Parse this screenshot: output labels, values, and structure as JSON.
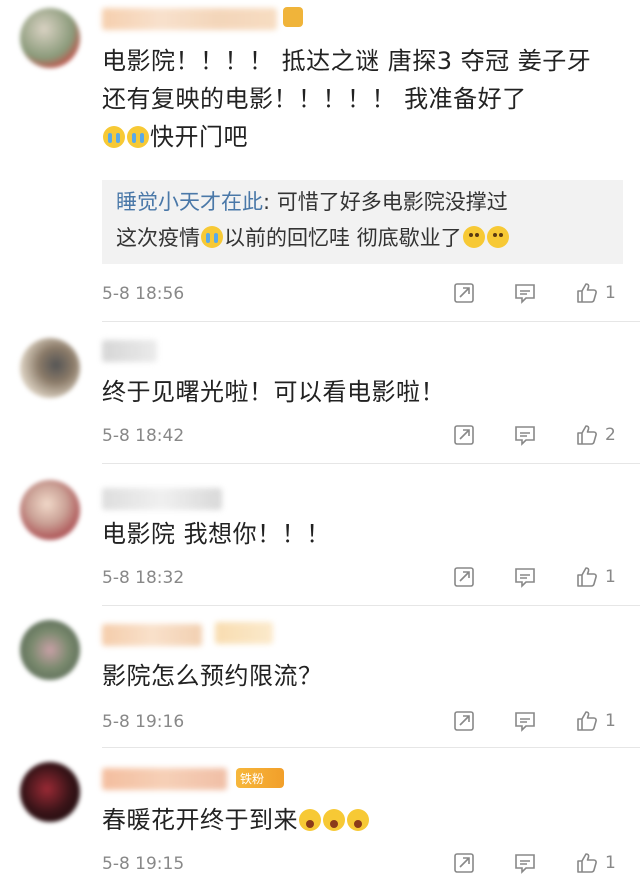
{
  "comments": [
    {
      "text": "电影院！！！！ 抵达之谜 唐探3 夺冠 姜子牙 还有复映的电影！！！！！ 我准备好了",
      "text_tail": "快开门吧",
      "reply": {
        "name": "睡觉小天才在此",
        "text1": ": 可惜了好多电影院没撑过",
        "text2a": "这次疫情",
        "text2b": "以前的回忆哇 彻底歇业了"
      },
      "time": "5-8 18:56",
      "likes": "1"
    },
    {
      "text": "终于见曙光啦！可以看电影啦！",
      "time": "5-8 18:42",
      "likes": "2"
    },
    {
      "text": "电影院 我想你！！！",
      "time": "5-8 18:32",
      "likes": "1"
    },
    {
      "text": "影院怎么预约限流？",
      "time": "5-8 19:16",
      "likes": "1"
    },
    {
      "text": "春暖花开终于到来",
      "badge": "铁粉",
      "time": "5-8 19:15",
      "likes": "1"
    }
  ],
  "colors": {
    "accent_link": "#4a78a8",
    "meta_gray": "#888888",
    "reply_bg": "#f2f2f2"
  },
  "icons": [
    "share-icon",
    "comment-icon",
    "like-icon"
  ]
}
